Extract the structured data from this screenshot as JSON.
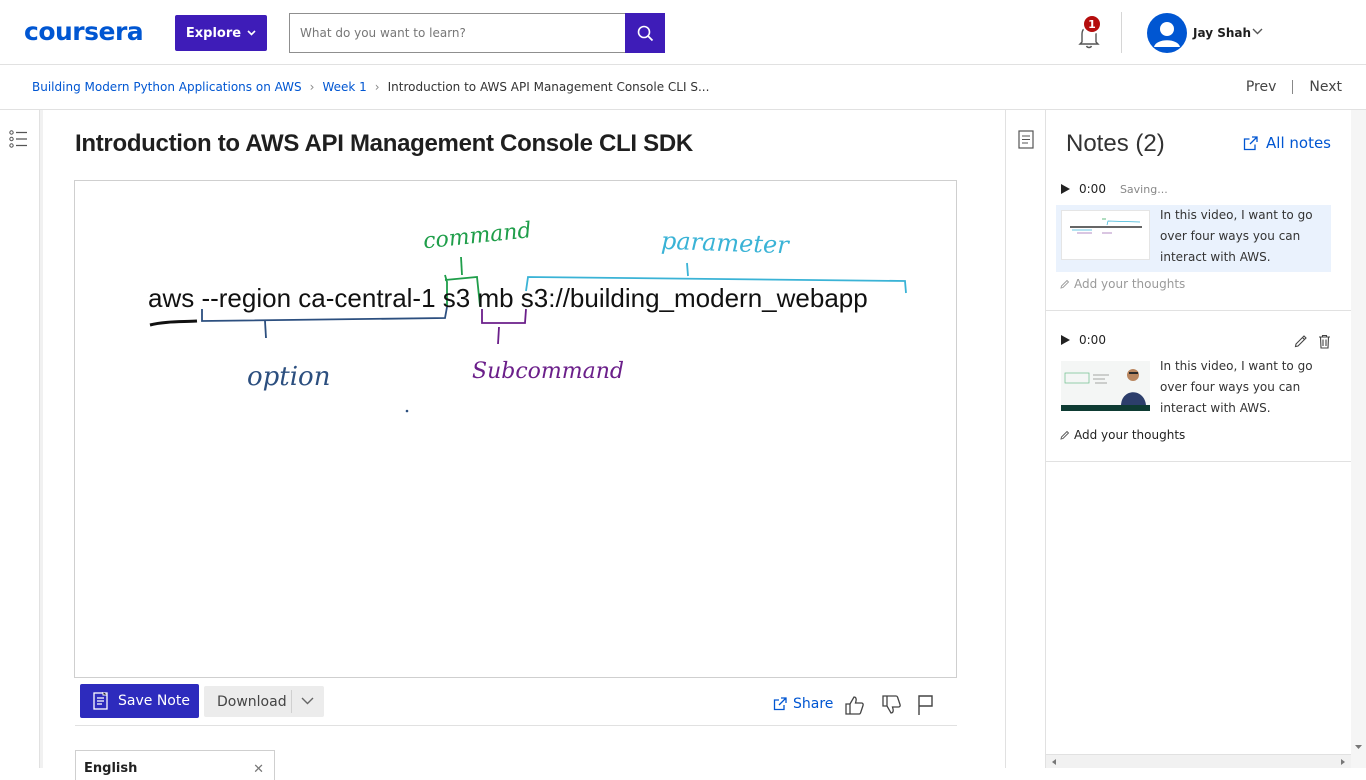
{
  "header": {
    "logo": "coursera",
    "explore_label": "Explore",
    "search_placeholder": "What do you want to learn?",
    "notification_count": "1",
    "user_name": "Jay Shah"
  },
  "breadcrumb": {
    "items": [
      "Building Modern Python Applications on AWS",
      "Week 1"
    ],
    "current": "Introduction to AWS API Management Console CLI S...",
    "prev_label": "Prev",
    "next_label": "Next"
  },
  "lesson": {
    "title": "Introduction to AWS API Management Console CLI SDK"
  },
  "video_frame": {
    "command_text": "aws --region ca-central-1 s3 mb s3://building_modern_webapp",
    "annotations": {
      "command": "command",
      "parameter": "parameter",
      "option": "option",
      "subcommand": "Subcommand"
    },
    "colors": {
      "command": "#1f9e4a",
      "parameter": "#3ab3d6",
      "option": "#2c4f7f",
      "subcommand": "#6b1f8a"
    }
  },
  "actions": {
    "save_note_label": "Save Note",
    "download_label": "Download",
    "share_label": "Share"
  },
  "language": {
    "selected": "English"
  },
  "notes": {
    "title": "Notes (2)",
    "all_notes_label": "All notes",
    "items": [
      {
        "time": "0:00",
        "status": "Saving...",
        "text": "In this video, I want to go over four ways you can interact with AWS.",
        "add_thoughts": "Add your thoughts"
      },
      {
        "time": "0:00",
        "text": "In this video, I want to go over four ways you can interact with AWS.",
        "add_thoughts": "Add your thoughts"
      }
    ]
  },
  "colors": {
    "brand": "#0056d2",
    "accent": "#3e1cb8",
    "badge": "#b50d0d"
  }
}
